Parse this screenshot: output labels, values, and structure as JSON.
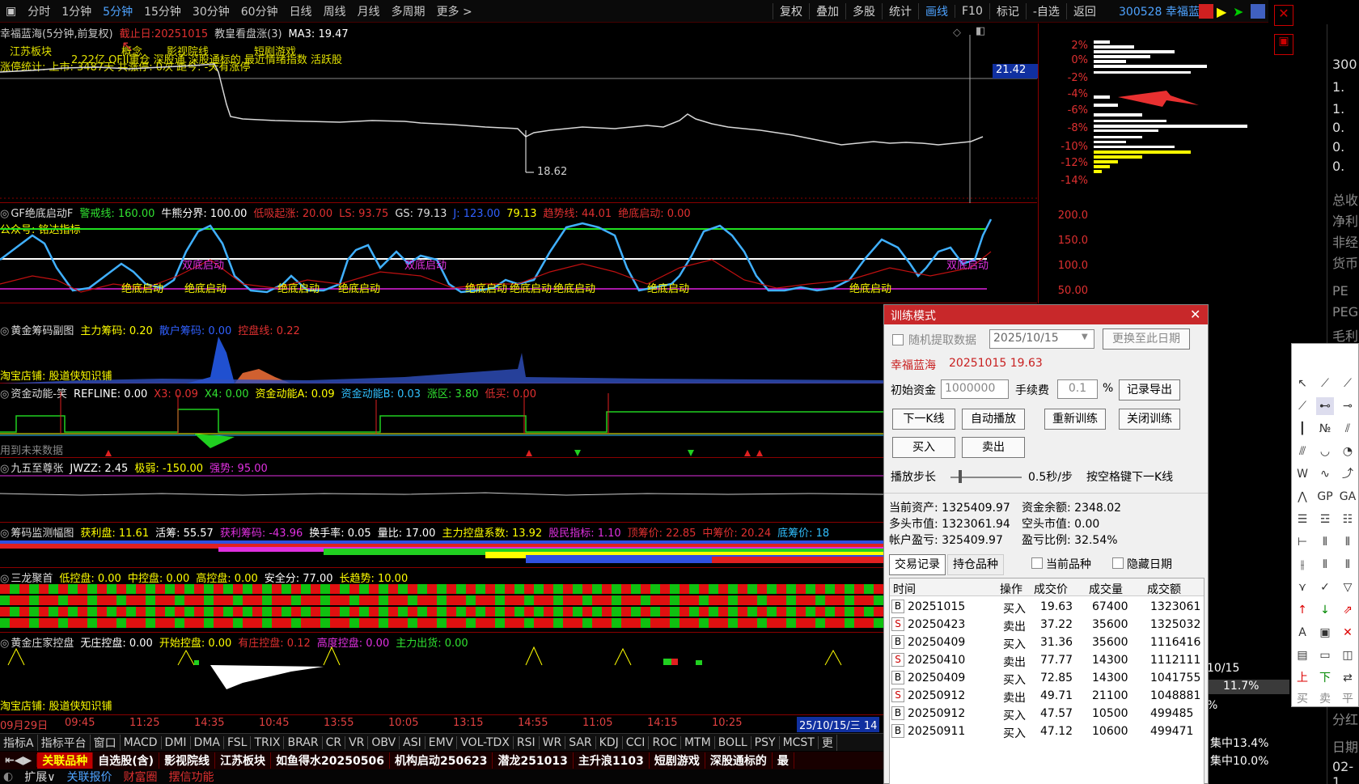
{
  "toolbar": {
    "periods": [
      "分时",
      "1分钟",
      "5分钟",
      "15分钟",
      "30分钟",
      "60分钟",
      "日线",
      "周线",
      "月线",
      "多周期",
      "更多 >"
    ],
    "active_period": "5分钟",
    "tools": [
      "复权",
      "叠加",
      "多股",
      "统计",
      "画线",
      "F10",
      "标记",
      "-自选",
      "返回"
    ],
    "stock": "300528 幸福蓝海"
  },
  "main": {
    "title": "幸福蓝海(5分钟,前复权)",
    "deadline": "截止日:20251015",
    "indicator": "教皇看盘涨(3)",
    "ma3": "MA3: 19.47",
    "tags": [
      "江苏板块",
      "概念",
      "影视院线",
      "短剧游戏"
    ],
    "line2": "2.22亿 QFII重仓 深股通 深股通标的 最近情绪指数 活跃股",
    "line3": "涨停统计: 上市: 3487天 共涨停: 0次 距今: -天有涨停",
    "low": "18.62",
    "price_tag": "21.42",
    "axis": [
      "2%",
      "0%",
      "-2%",
      "-4%",
      "-6%",
      "-8%",
      "-10%",
      "-12%",
      "-14%"
    ]
  },
  "p1": {
    "name": "GF绝底启动F",
    "items": [
      "警戒线: 160.00",
      "牛熊分界: 100.00",
      "低吸起涨: 20.00",
      "LS: 93.75",
      "GS: 79.13",
      "J: 123.00",
      "79.13",
      "趋势线: 44.01",
      "绝底启动: 0.00"
    ],
    "note": "公众号: 铭达指标",
    "axis": [
      "200.0",
      "150.0",
      "100.0",
      "50.00"
    ],
    "labels": [
      "绝底启动",
      "绝底启动",
      "绝底启动",
      "绝底启动",
      "绝底启动",
      "绝底启动",
      "绝底启动",
      "绝底启动",
      "绝底启动",
      "双底启动",
      "双底启动",
      "双底启动"
    ]
  },
  "p2": {
    "name": "黄金筹码副图",
    "items": [
      "主力筹码: 0.20",
      "散户筹码: 0.00",
      "控盘线: 0.22"
    ],
    "note": "淘宝店铺: 股道侠知识铺"
  },
  "p3": {
    "name": "资金动能-笑",
    "items": [
      "REFLINE: 0.00",
      "X3: 0.09",
      "X4: 0.00",
      "资金动能A: 0.09",
      "资金动能B: 0.03",
      "涨区: 3.80",
      "低买: 0.00"
    ],
    "note": "用到未来数据"
  },
  "p4": {
    "name": "九五至尊张",
    "items": [
      "JWZZ: 2.45",
      "极弱: -150.00",
      "强势: 95.00"
    ]
  },
  "p5": {
    "name": "筹码监测幅图",
    "items": [
      "获利盘: 11.61",
      "活筹: 55.57",
      "获利筹码: -43.96",
      "换手率: 0.05",
      "量比: 17.00",
      "主力控盘系数: 13.92",
      "股民指标: 1.10",
      "顶筹价: 22.85",
      "中筹价: 20.24",
      "底筹价: 18"
    ]
  },
  "p6": {
    "name": "三龙聚首",
    "items": [
      "低控盘: 0.00",
      "中控盘: 0.00",
      "高控盘: 0.00",
      "安全分: 77.00",
      "长趋势: 10.00"
    ]
  },
  "p7": {
    "name": "黄金庄家控盘",
    "items": [
      "无庄控盘: 0.00",
      "开始控盘: 0.00",
      "有庄控盘: 0.12",
      "高度控盘: 0.00",
      "主力出货: 0.00"
    ],
    "note": "淘宝店铺: 股道侠知识铺"
  },
  "xaxis": [
    "09月29日",
    "09:45",
    "11:25",
    "14:35",
    "10:45",
    "13:55",
    "10:05",
    "13:15",
    "14:55",
    "11:05",
    "14:15",
    "10:25",
    "25/10/15/三 14"
  ],
  "itabs": [
    "指标A",
    "指标平台",
    "窗口",
    "MACD",
    "DMI",
    "DMA",
    "FSL",
    "TRIX",
    "BRAR",
    "CR",
    "VR",
    "OBV",
    "ASI",
    "EMV",
    "VOL-TDX",
    "RSI",
    "WR",
    "SAR",
    "KDJ",
    "CCI",
    "ROC",
    "MTM",
    "BOLL",
    "PSY",
    "MCST",
    "更"
  ],
  "btabs": [
    "关联品种",
    "自选股(含)",
    "影视院线",
    "江苏板块",
    "如鱼得水20250506",
    "机构启动250623",
    "潜龙251013",
    "主升浪1103",
    "短剧游戏",
    "深股通标的",
    "最"
  ],
  "status": [
    "扩展∨",
    "关联报价",
    "财富圈",
    "摆信功能"
  ],
  "rpanel": [
    "300",
    "1.",
    "1.",
    "0.",
    "0.",
    "0.",
    "总收",
    "净利",
    "非经",
    "货币",
    "PE",
    "PEG",
    "毛利",
    "分红",
    "日期",
    "02-1"
  ],
  "overlay": {
    "date": "10/15",
    "pct": "11.7%",
    "c1": "集中13.4%",
    "c2": "集中10.0%",
    "pctsign": "%"
  },
  "drawtools": {
    "buy": "买",
    "sell": "卖",
    "flat": "平"
  },
  "dialog": {
    "title": "训练模式",
    "random": "随机提取数据",
    "date": "2025/10/15",
    "change_date": "更换至此日期",
    "stock_line": "幸福蓝海",
    "stock_price": "20251015  19.63",
    "capital_label": "初始资金",
    "capital": "1000000",
    "fee_label": "手续费",
    "fee": "0.1",
    "pct": "%",
    "export": "记录导出",
    "next": "下一K线",
    "auto": "自动播放",
    "retrain": "重新训练",
    "close_train": "关闭训练",
    "buy": "买入",
    "sell": "卖出",
    "step_label": "播放步长",
    "step_val": "0.5秒/步",
    "space_hint": "按空格键下一K线",
    "assets": "当前资产: 1325409.97",
    "cash": "资金余额: 2348.02",
    "long": "多头市值: 1323061.94",
    "short": "空头市值: 0.00",
    "pnl": "帐户盈亏: 325409.97",
    "ratio": "盈亏比例: 32.54%",
    "tab1": "交易记录",
    "tab2": "持仓品种",
    "cur_only": "当前品种",
    "hide_date": "隐藏日期",
    "cols": [
      "时间",
      "操作",
      "成交价",
      "成交量",
      "成交额"
    ],
    "rows": [
      {
        "t": "B",
        "d": "20251015",
        "op": "买入",
        "p": "19.63",
        "v": "67400",
        "a": "1323061"
      },
      {
        "t": "S",
        "d": "20250423",
        "op": "卖出",
        "p": "37.22",
        "v": "35600",
        "a": "1325032"
      },
      {
        "t": "B",
        "d": "20250409",
        "op": "买入",
        "p": "31.36",
        "v": "35600",
        "a": "1116416"
      },
      {
        "t": "S",
        "d": "20250410",
        "op": "卖出",
        "p": "77.77",
        "v": "14300",
        "a": "1112111"
      },
      {
        "t": "B",
        "d": "20250409",
        "op": "买入",
        "p": "72.85",
        "v": "14300",
        "a": "1041755"
      },
      {
        "t": "S",
        "d": "20250912",
        "op": "卖出",
        "p": "49.71",
        "v": "21100",
        "a": "1048881"
      },
      {
        "t": "B",
        "d": "20250912",
        "op": "买入",
        "p": "47.57",
        "v": "10500",
        "a": "499485"
      },
      {
        "t": "B",
        "d": "20250911",
        "op": "买入",
        "p": "47.12",
        "v": "10600",
        "a": "499471"
      }
    ]
  }
}
